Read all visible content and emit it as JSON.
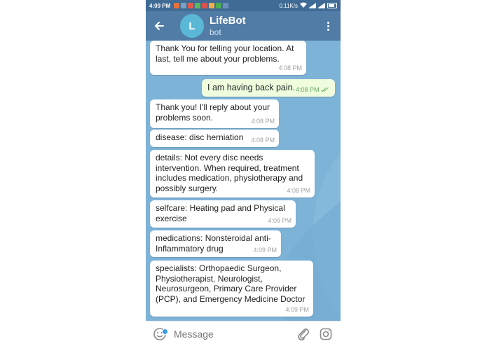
{
  "status_bar": {
    "time": "4:09 PM",
    "speed": "0.11K/s",
    "icons": [
      "notification-icon",
      "gmail-icon",
      "app-icon",
      "play-store-icon",
      "wifi-icon",
      "signal-icon",
      "battery-icon"
    ]
  },
  "header": {
    "avatar_letter": "L",
    "title": "LifeBot",
    "subtitle": "bot",
    "back_icon": "arrow-left-icon",
    "menu_icon": "more-vertical-icon"
  },
  "messages": [
    {
      "text": "Thank You for telling your location. At last, tell me about your problems.",
      "time": "4:08 PM",
      "direction": "in"
    },
    {
      "text": "I am having back pain.",
      "time": "4:08 PM",
      "direction": "out"
    },
    {
      "text": "Thank you! I'll reply about your problems soon.",
      "time": "4:08 PM",
      "direction": "in"
    },
    {
      "text": "disease: disc herniation",
      "time": "4:08 PM",
      "direction": "in"
    },
    {
      "text": "details: Not every disc needs intervention. When required, treatment includes medication, physiotherapy and possibly surgery.",
      "time": "4:08 PM",
      "direction": "in"
    },
    {
      "text": "selfcare: Heating pad and Physical exercise",
      "time": "4:09 PM",
      "direction": "in"
    },
    {
      "text": "medications: Nonsteroidal anti-Inflammatory drug",
      "time": "4:09 PM",
      "direction": "in"
    },
    {
      "text": "specialists: Orthopaedic Surgeon, Physiotherapist, Neurologist, Neurosurgeon, Primary Care Provider (PCP), and Emergency Medicine Doctor",
      "time": "4:09 PM",
      "direction": "in"
    }
  ],
  "input": {
    "placeholder": "Message",
    "emoji_icon": "emoji-icon",
    "attach_icon": "paperclip-icon",
    "camera_icon": "camera-icon"
  },
  "colors": {
    "status_bar": "#3f6b94",
    "header": "#517ca5",
    "chat_background": "#7eb3d8",
    "outgoing_bubble": "#effdde",
    "avatar": "#5ab7d6"
  }
}
